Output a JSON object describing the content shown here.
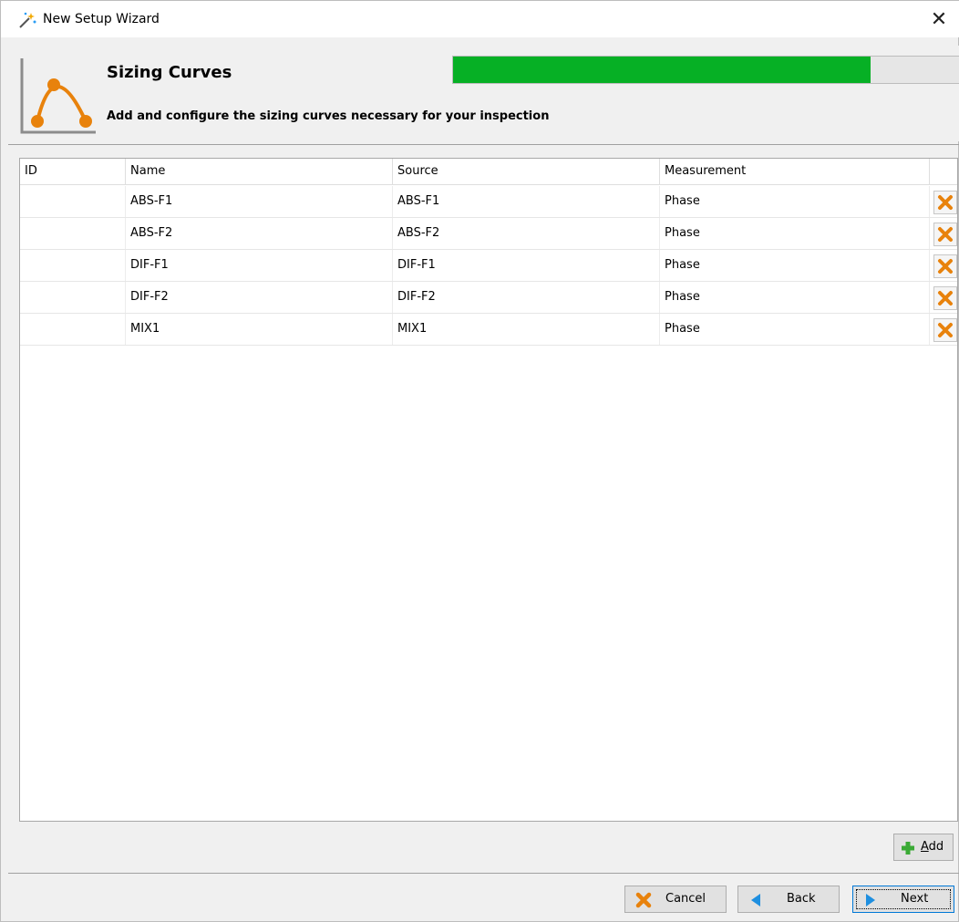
{
  "window": {
    "title": "New Setup Wizard",
    "close_glyph": "✕"
  },
  "header": {
    "step_title": "Sizing Curves",
    "step_description": "Add and configure the sizing curves necessary for your inspection",
    "icon": "sizing-curve-icon",
    "progress_percent": 82,
    "progress_color": "#06b025",
    "accent_color": "#e8820c"
  },
  "table": {
    "columns": [
      "ID",
      "Name",
      "Source",
      "Measurement"
    ],
    "rows": [
      {
        "id": "",
        "name": "ABS-F1",
        "source": "ABS-F1",
        "measurement": "Phase"
      },
      {
        "id": "",
        "name": "ABS-F2",
        "source": "ABS-F2",
        "measurement": "Phase"
      },
      {
        "id": "",
        "name": "DIF-F1",
        "source": "DIF-F1",
        "measurement": "Phase"
      },
      {
        "id": "",
        "name": "DIF-F2",
        "source": "DIF-F2",
        "measurement": "Phase"
      },
      {
        "id": "",
        "name": "MIX1",
        "source": "MIX1",
        "measurement": "Phase"
      }
    ],
    "row_action_icon": "delete-x-icon"
  },
  "buttons": {
    "add": {
      "mnemonic": "A",
      "rest": "dd",
      "icon": "plus-icon"
    },
    "cancel": {
      "label": "Cancel",
      "icon": "x-icon"
    },
    "back": {
      "label": "Back",
      "icon": "left-arrow-icon"
    },
    "next": {
      "label": "Next",
      "icon": "right-arrow-icon"
    }
  }
}
